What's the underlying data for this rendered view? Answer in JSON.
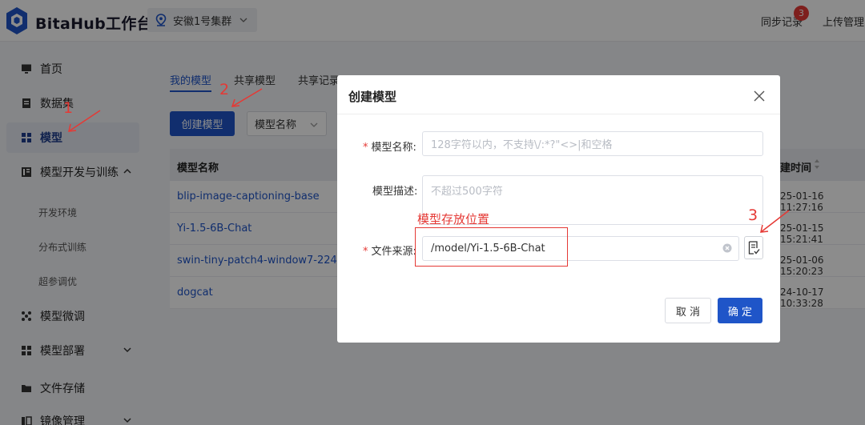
{
  "header": {
    "brand": "BitaHub工作台",
    "cluster": "安徽1号集群",
    "sync_records": "同步记录",
    "sync_badge": "3",
    "upload_manage": "上传管理"
  },
  "sidebar": {
    "items": [
      {
        "label": "首页",
        "icon": "monitor-icon"
      },
      {
        "label": "数据集",
        "icon": "dataset-icon"
      },
      {
        "label": "模型",
        "icon": "grid-icon"
      },
      {
        "label": "模型开发与训练",
        "icon": "code-icon"
      },
      {
        "label": "模型微调",
        "icon": "tune-icon"
      },
      {
        "label": "模型部署",
        "icon": "deploy-icon"
      },
      {
        "label": "文件存储",
        "icon": "folder-icon"
      },
      {
        "label": "镜像管理",
        "icon": "image-icon"
      }
    ],
    "sub_items": [
      "开发环境",
      "分布式训练",
      "超参调优"
    ]
  },
  "main": {
    "tabs": [
      "我的模型",
      "共享模型",
      "共享记录"
    ],
    "create_button": "创建模型",
    "filter_select": "模型名称",
    "table": {
      "col_name": "模型名称",
      "col_time": "创建时间",
      "col_time_visible": "建时间",
      "rows": [
        {
          "name": "blip-image-captioning-base",
          "time": "25-01-16 11:27:16"
        },
        {
          "name": "Yi-1.5-6B-Chat",
          "time": "25-01-15 15:21:41"
        },
        {
          "name": "swin-tiny-patch4-window7-224",
          "time": "25-01-06 15:20:23"
        },
        {
          "name": "dogcat",
          "time": "24-10-17 10:33:28"
        }
      ]
    }
  },
  "modal": {
    "title": "创建模型",
    "name_label": "模型名称:",
    "name_placeholder": "128字符以内，不支持\\/:*?\"<>|和空格",
    "desc_label": "模型描述:",
    "desc_placeholder": "不超过500字符",
    "source_label": "文件来源:",
    "source_value": "/model/Yi-1.5-6B-Chat",
    "cancel": "取 消",
    "ok": "确 定"
  },
  "annotations": {
    "box_label": "模型存放位置",
    "num1": "1",
    "num2": "2",
    "num3": "3",
    "color": "#e53935"
  },
  "colors": {
    "primary": "#1f55c8",
    "danger": "#e53935"
  }
}
